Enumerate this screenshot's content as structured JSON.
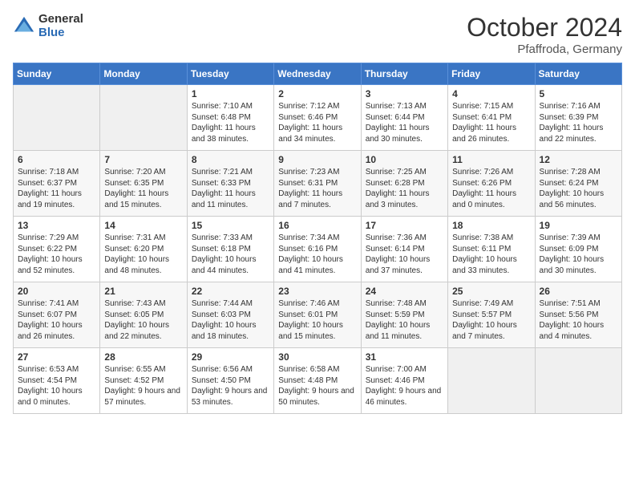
{
  "header": {
    "logo_general": "General",
    "logo_blue": "Blue",
    "month_title": "October 2024",
    "location": "Pfaffroda, Germany"
  },
  "days_of_week": [
    "Sunday",
    "Monday",
    "Tuesday",
    "Wednesday",
    "Thursday",
    "Friday",
    "Saturday"
  ],
  "weeks": [
    [
      {
        "day": "",
        "info": ""
      },
      {
        "day": "",
        "info": ""
      },
      {
        "day": "1",
        "info": "Sunrise: 7:10 AM\nSunset: 6:48 PM\nDaylight: 11 hours and 38 minutes."
      },
      {
        "day": "2",
        "info": "Sunrise: 7:12 AM\nSunset: 6:46 PM\nDaylight: 11 hours and 34 minutes."
      },
      {
        "day": "3",
        "info": "Sunrise: 7:13 AM\nSunset: 6:44 PM\nDaylight: 11 hours and 30 minutes."
      },
      {
        "day": "4",
        "info": "Sunrise: 7:15 AM\nSunset: 6:41 PM\nDaylight: 11 hours and 26 minutes."
      },
      {
        "day": "5",
        "info": "Sunrise: 7:16 AM\nSunset: 6:39 PM\nDaylight: 11 hours and 22 minutes."
      }
    ],
    [
      {
        "day": "6",
        "info": "Sunrise: 7:18 AM\nSunset: 6:37 PM\nDaylight: 11 hours and 19 minutes."
      },
      {
        "day": "7",
        "info": "Sunrise: 7:20 AM\nSunset: 6:35 PM\nDaylight: 11 hours and 15 minutes."
      },
      {
        "day": "8",
        "info": "Sunrise: 7:21 AM\nSunset: 6:33 PM\nDaylight: 11 hours and 11 minutes."
      },
      {
        "day": "9",
        "info": "Sunrise: 7:23 AM\nSunset: 6:31 PM\nDaylight: 11 hours and 7 minutes."
      },
      {
        "day": "10",
        "info": "Sunrise: 7:25 AM\nSunset: 6:28 PM\nDaylight: 11 hours and 3 minutes."
      },
      {
        "day": "11",
        "info": "Sunrise: 7:26 AM\nSunset: 6:26 PM\nDaylight: 11 hours and 0 minutes."
      },
      {
        "day": "12",
        "info": "Sunrise: 7:28 AM\nSunset: 6:24 PM\nDaylight: 10 hours and 56 minutes."
      }
    ],
    [
      {
        "day": "13",
        "info": "Sunrise: 7:29 AM\nSunset: 6:22 PM\nDaylight: 10 hours and 52 minutes."
      },
      {
        "day": "14",
        "info": "Sunrise: 7:31 AM\nSunset: 6:20 PM\nDaylight: 10 hours and 48 minutes."
      },
      {
        "day": "15",
        "info": "Sunrise: 7:33 AM\nSunset: 6:18 PM\nDaylight: 10 hours and 44 minutes."
      },
      {
        "day": "16",
        "info": "Sunrise: 7:34 AM\nSunset: 6:16 PM\nDaylight: 10 hours and 41 minutes."
      },
      {
        "day": "17",
        "info": "Sunrise: 7:36 AM\nSunset: 6:14 PM\nDaylight: 10 hours and 37 minutes."
      },
      {
        "day": "18",
        "info": "Sunrise: 7:38 AM\nSunset: 6:11 PM\nDaylight: 10 hours and 33 minutes."
      },
      {
        "day": "19",
        "info": "Sunrise: 7:39 AM\nSunset: 6:09 PM\nDaylight: 10 hours and 30 minutes."
      }
    ],
    [
      {
        "day": "20",
        "info": "Sunrise: 7:41 AM\nSunset: 6:07 PM\nDaylight: 10 hours and 26 minutes."
      },
      {
        "day": "21",
        "info": "Sunrise: 7:43 AM\nSunset: 6:05 PM\nDaylight: 10 hours and 22 minutes."
      },
      {
        "day": "22",
        "info": "Sunrise: 7:44 AM\nSunset: 6:03 PM\nDaylight: 10 hours and 18 minutes."
      },
      {
        "day": "23",
        "info": "Sunrise: 7:46 AM\nSunset: 6:01 PM\nDaylight: 10 hours and 15 minutes."
      },
      {
        "day": "24",
        "info": "Sunrise: 7:48 AM\nSunset: 5:59 PM\nDaylight: 10 hours and 11 minutes."
      },
      {
        "day": "25",
        "info": "Sunrise: 7:49 AM\nSunset: 5:57 PM\nDaylight: 10 hours and 7 minutes."
      },
      {
        "day": "26",
        "info": "Sunrise: 7:51 AM\nSunset: 5:56 PM\nDaylight: 10 hours and 4 minutes."
      }
    ],
    [
      {
        "day": "27",
        "info": "Sunrise: 6:53 AM\nSunset: 4:54 PM\nDaylight: 10 hours and 0 minutes."
      },
      {
        "day": "28",
        "info": "Sunrise: 6:55 AM\nSunset: 4:52 PM\nDaylight: 9 hours and 57 minutes."
      },
      {
        "day": "29",
        "info": "Sunrise: 6:56 AM\nSunset: 4:50 PM\nDaylight: 9 hours and 53 minutes."
      },
      {
        "day": "30",
        "info": "Sunrise: 6:58 AM\nSunset: 4:48 PM\nDaylight: 9 hours and 50 minutes."
      },
      {
        "day": "31",
        "info": "Sunrise: 7:00 AM\nSunset: 4:46 PM\nDaylight: 9 hours and 46 minutes."
      },
      {
        "day": "",
        "info": ""
      },
      {
        "day": "",
        "info": ""
      }
    ]
  ]
}
